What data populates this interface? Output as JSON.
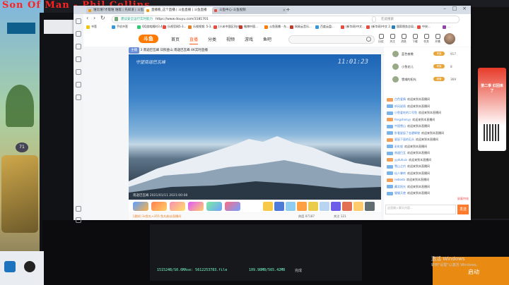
{
  "overlay": {
    "song_title": "Son Of Man - Phil Collins",
    "badge_number": "71"
  },
  "browser": {
    "tabs": [
      {
        "label": "谁比谁?才能谁 谁能 | 先知道 | 斗鱼..."
      },
      {
        "label": "直播看_这个直播 | 斗鱼直播 | 斗鱼直播"
      },
      {
        "label": "斗鱼中心-斗鱼视频"
      }
    ],
    "url": "https://www.douyu.com/3181701",
    "url_prefix": "建议安全运行实时能力",
    "search_placeholder": "在此搜索"
  },
  "bookmarks": [
    {
      "label": "书签",
      "color": "#f1c40f"
    },
    {
      "label": "手机书签",
      "color": "#3498db"
    },
    {
      "label": "QQ游戏随时3.4.1",
      "color": "#2ecc71"
    },
    {
      "label": "乐视官网5-3...",
      "color": "#e74c3c"
    },
    {
      "label": "乐视视频: 5-3...",
      "color": "#e67e22"
    },
    {
      "label": "[小米中国区]在线...",
      "color": "#e74c3c"
    },
    {
      "label": "微博中国...",
      "color": "#c0392b"
    },
    {
      "label": "斗鱼直播 - 东...",
      "color": "#ff7a00"
    },
    {
      "label": "网易云音乐...",
      "color": "#c0392b"
    },
    {
      "label": "百度云盘...",
      "color": "#3498db"
    },
    {
      "label": "(新华网)中文...",
      "color": "#e74c3c"
    },
    {
      "label": "(新华网)中文 2...",
      "color": "#e74c3c"
    },
    {
      "label": "国家税务总局...",
      "color": "#2980b9"
    },
    {
      "label": "中央...",
      "color": "#e74c3c"
    },
    {
      "label": "...",
      "color": "#8e44ad"
    }
  ],
  "header": {
    "logo": "斗鱼",
    "nav": [
      "首页",
      "直播",
      "分类",
      "视频",
      "游戏",
      "鱼吧"
    ],
    "active_nav": "直播",
    "icons": [
      {
        "name": "history-icon",
        "label": "历史"
      },
      {
        "name": "follow-icon",
        "label": "关注"
      },
      {
        "name": "message-icon",
        "label": "消息"
      },
      {
        "name": "download-icon",
        "label": "下载"
      },
      {
        "name": "task-icon",
        "label": "任务"
      },
      {
        "name": "live-icon",
        "label": "开播"
      }
    ]
  },
  "room": {
    "tag": "主播",
    "title": "3 南迦巴瓦峰 日照金山 南迦巴瓦峰 4K实时直播"
  },
  "video": {
    "caption_tl": "守望南迦巴瓦峰",
    "clock": "11:01:23",
    "caption_bl": "南迦巴瓦峰 2021/01/11 2021:00:08"
  },
  "gifts_bar_text": "[通知] 3s鱼丸+355:鱼丸粉丝直播间",
  "bottom_info": {
    "views": "热度 97187",
    "likes": "关注 121"
  },
  "rank": [
    {
      "name": "蓝色夜晚",
      "badge": "贵族",
      "score": "917"
    },
    {
      "name": "小鱼花儿",
      "badge": "贵族",
      "score": "8"
    },
    {
      "name": "雪域的阳光",
      "badge": "超管",
      "score": "369"
    }
  ],
  "chat": [
    {
      "user": "白色爱情",
      "text": "欢迎来到本直播间"
    },
    {
      "user": "听风说雨",
      "text": "欢迎来到本直播间"
    },
    {
      "user": "小鱼爱吃的二号鱼",
      "text": "欢迎来到本直播间"
    },
    {
      "user": "fengshenyy",
      "text": "欢迎来到本直播间"
    },
    {
      "user": "中国雪山",
      "text": "欢迎来到本直播间"
    },
    {
      "user": "卧看星辰了金碧辉煌",
      "text": "欢迎来到本直播间"
    },
    {
      "user": "星辰下面的石头",
      "text": "欢迎来到本直播间"
    },
    {
      "user": "彩虹般",
      "text": "欢迎来到本直播间"
    },
    {
      "user": "南迦巴瓦",
      "text": "欢迎来到本直播间"
    },
    {
      "user": "yyduhuis",
      "text": "欢迎来到本直播间"
    },
    {
      "user": "雪山之约",
      "text": "欢迎来到本直播间"
    },
    {
      "user": "仙人掌的",
      "text": "欢迎来到本直播间"
    },
    {
      "user": "neboda",
      "text": "欢迎来到本直播间"
    },
    {
      "user": "藏北阳光",
      "text": "欢迎来到本直播间"
    },
    {
      "user": "猫猫天使",
      "text": "欢迎来到本直播间"
    }
  ],
  "chat_input": {
    "placeholder": "这里输入聊天内容...",
    "send": "发送",
    "tools": "屏蔽特效"
  },
  "ad": {
    "text": "第二季 红回来了"
  },
  "bottom_panel": {
    "line1": "151524B/S0.6MAse: 5612253783.file",
    "line2": "109.98MB/565.42MB",
    "status": "完成"
  },
  "activate": {
    "title": "激活 Windows",
    "subtitle": "转到\"设置\"以激活 Windows。",
    "button": "启动"
  }
}
